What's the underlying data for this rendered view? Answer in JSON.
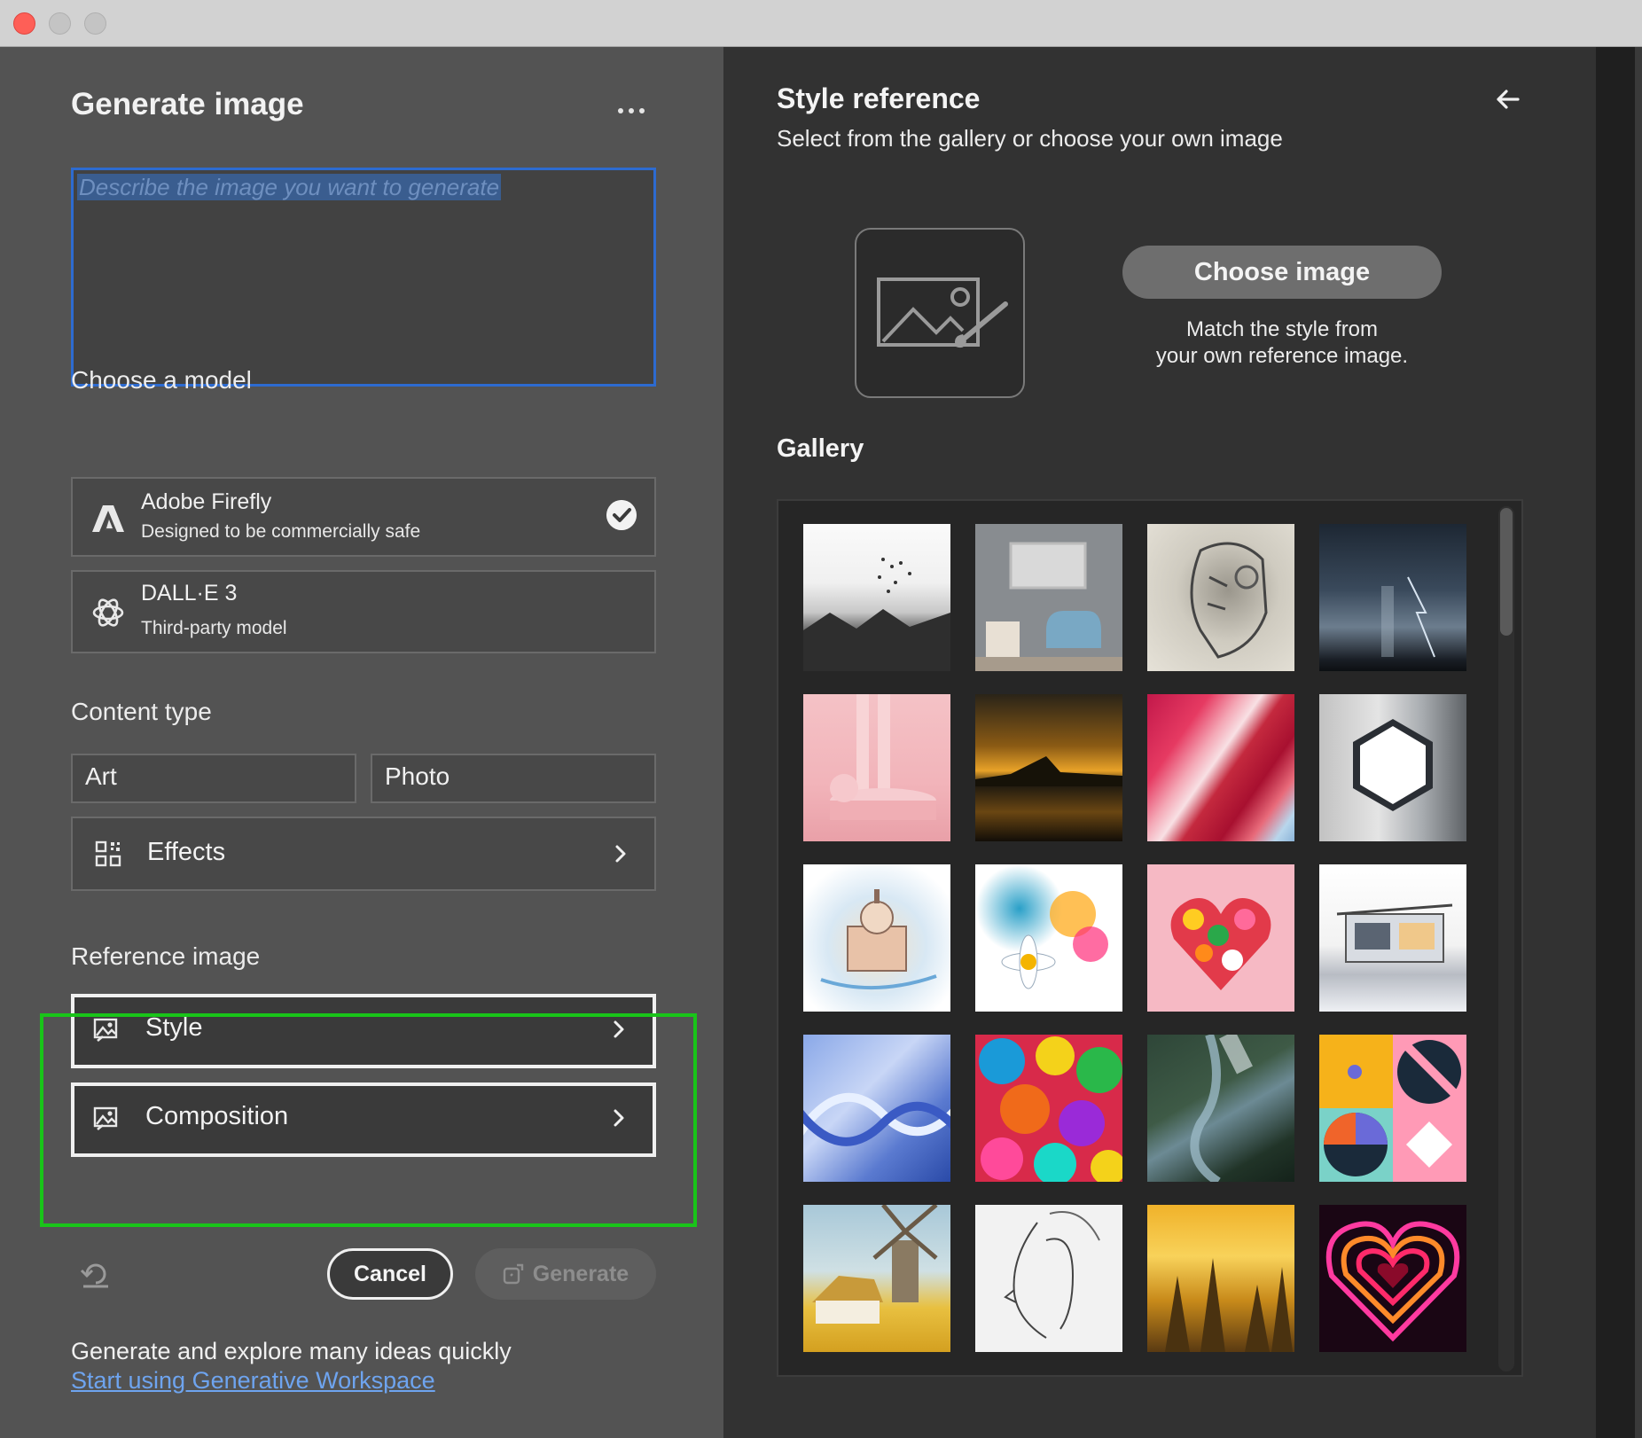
{
  "left_panel": {
    "title": "Generate image",
    "prompt_placeholder": "Describe the image you want to generate",
    "model_section_label": "Choose a model",
    "models": [
      {
        "name": "Adobe Firefly",
        "description": "Designed to be commercially safe",
        "selected": true,
        "icon": "adobe-logo-icon"
      },
      {
        "name": "DALL·E 3",
        "description": "Third-party model",
        "selected": false,
        "icon": "openai-logo-icon"
      }
    ],
    "content_type_label": "Content type",
    "content_types": [
      "Art",
      "Photo"
    ],
    "effects_label": "Effects",
    "reference_label": "Reference image",
    "reference_options": [
      "Style",
      "Composition"
    ],
    "cancel_label": "Cancel",
    "generate_label": "Generate",
    "footer_text": "Generate and explore many ideas quickly",
    "footer_link": "Start using Generative Workspace"
  },
  "right_panel": {
    "title": "Style reference",
    "subtitle": "Select from the gallery or choose your own image",
    "choose_button": "Choose image",
    "choose_hint_line1": "Match the style from",
    "choose_hint_line2": "your own reference image.",
    "gallery_label": "Gallery",
    "gallery_items": [
      "ink-mountains-birds",
      "room-blue-chair",
      "sketch-robot-head",
      "storm-clouds",
      "pink-podium",
      "starry-lake",
      "red-fabric-waves",
      "white-hexagon",
      "watercolor-cathedral",
      "watercolor-daisies",
      "flower-heart",
      "sketch-modern-house",
      "blue-dna",
      "paper-rosettes",
      "aerial-river-valley",
      "geometric-shapes",
      "painted-windmill",
      "pencil-face-sketch",
      "golden-foggy-forest",
      "neon-heart"
    ]
  },
  "colors": {
    "accent_blue": "#2d6bd0",
    "link_blue": "#6ea4ef",
    "highlight_green": "#19c419"
  }
}
